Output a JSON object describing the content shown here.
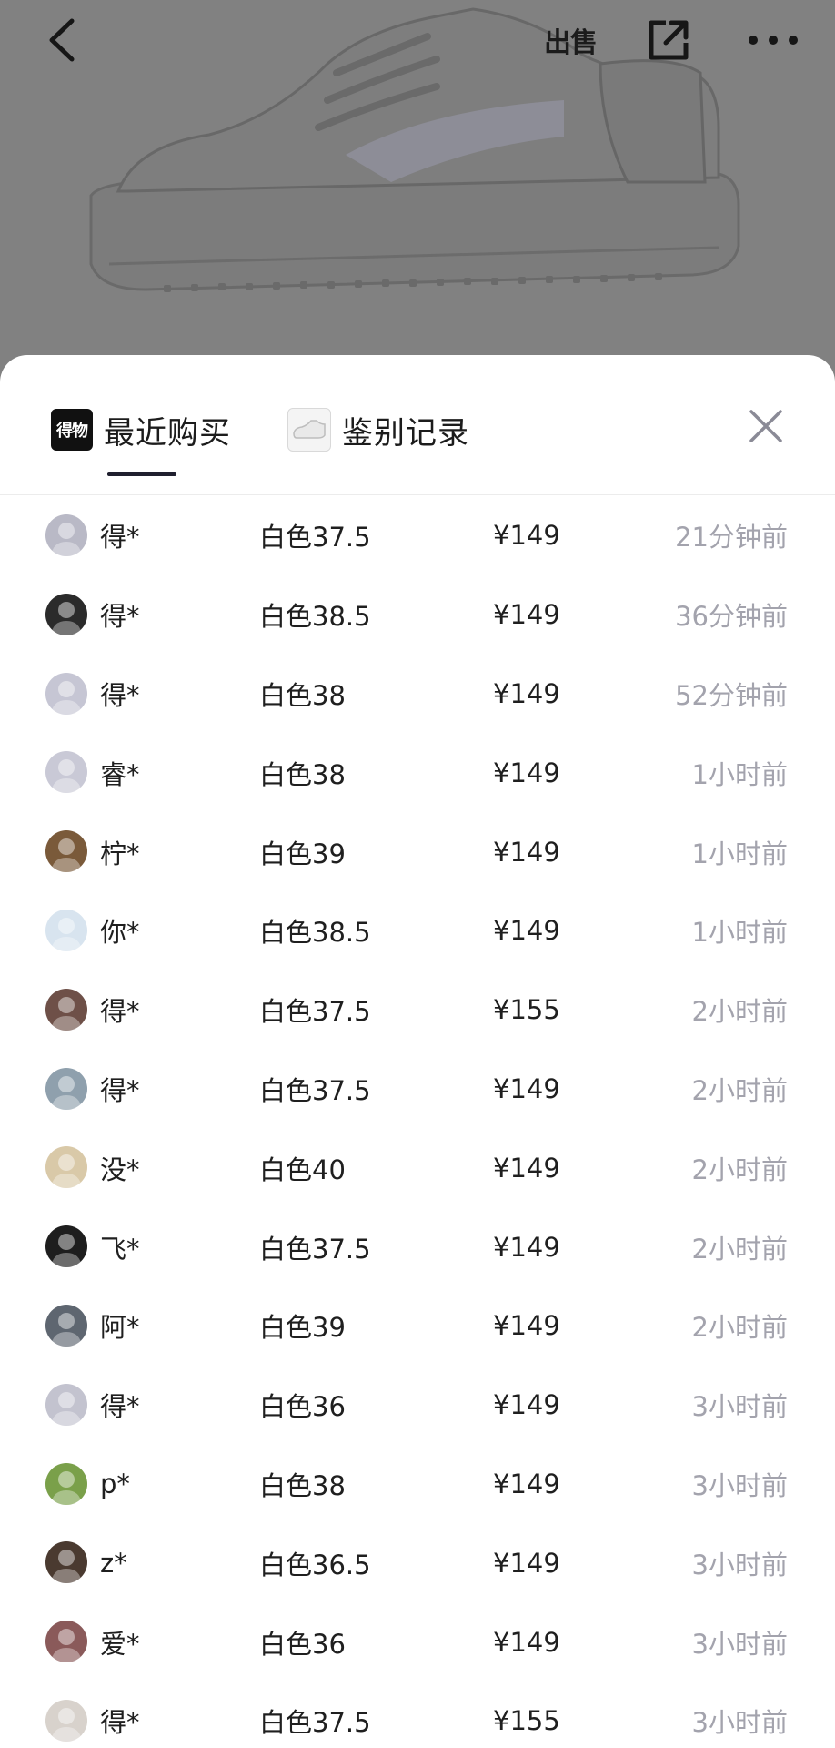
{
  "topbar": {
    "sell_label": "出售"
  },
  "tabs": [
    {
      "label": "最近购买",
      "icon_text": "得物",
      "active": true
    },
    {
      "label": "鉴别记录",
      "active": false
    }
  ],
  "records": [
    {
      "user": "得*",
      "spec": "白色37.5",
      "price": "¥149",
      "time": "21分钟前",
      "avatar_color": "#b9b9c6"
    },
    {
      "user": "得*",
      "spec": "白色38.5",
      "price": "¥149",
      "time": "36分钟前",
      "avatar_color": "#2b2b2b"
    },
    {
      "user": "得*",
      "spec": "白色38",
      "price": "¥149",
      "time": "52分钟前",
      "avatar_color": "#c6c6d4"
    },
    {
      "user": "睿*",
      "spec": "白色38",
      "price": "¥149",
      "time": "1小时前",
      "avatar_color": "#c9c9d6"
    },
    {
      "user": "柠*",
      "spec": "白色39",
      "price": "¥149",
      "time": "1小时前",
      "avatar_color": "#7a5a3a"
    },
    {
      "user": "你*",
      "spec": "白色38.5",
      "price": "¥149",
      "time": "1小时前",
      "avatar_color": "#d8e4ef"
    },
    {
      "user": "得*",
      "spec": "白色37.5",
      "price": "¥155",
      "time": "2小时前",
      "avatar_color": "#6e5048"
    },
    {
      "user": "得*",
      "spec": "白色37.5",
      "price": "¥149",
      "time": "2小时前",
      "avatar_color": "#8fa0ad"
    },
    {
      "user": "没*",
      "spec": "白色40",
      "price": "¥149",
      "time": "2小时前",
      "avatar_color": "#d9c9a8"
    },
    {
      "user": "飞*",
      "spec": "白色37.5",
      "price": "¥149",
      "time": "2小时前",
      "avatar_color": "#1e1e1e"
    },
    {
      "user": "阿*",
      "spec": "白色39",
      "price": "¥149",
      "time": "2小时前",
      "avatar_color": "#5e6670"
    },
    {
      "user": "得*",
      "spec": "白色36",
      "price": "¥149",
      "time": "3小时前",
      "avatar_color": "#c3c3cf"
    },
    {
      "user": "p*",
      "spec": "白色38",
      "price": "¥149",
      "time": "3小时前",
      "avatar_color": "#7aa04a"
    },
    {
      "user": "z*",
      "spec": "白色36.5",
      "price": "¥149",
      "time": "3小时前",
      "avatar_color": "#4a3a30"
    },
    {
      "user": "爱*",
      "spec": "白色36",
      "price": "¥149",
      "time": "3小时前",
      "avatar_color": "#8a5a5a"
    },
    {
      "user": "得*",
      "spec": "白色37.5",
      "price": "¥155",
      "time": "3小时前",
      "avatar_color": "#d8d2cc"
    }
  ]
}
